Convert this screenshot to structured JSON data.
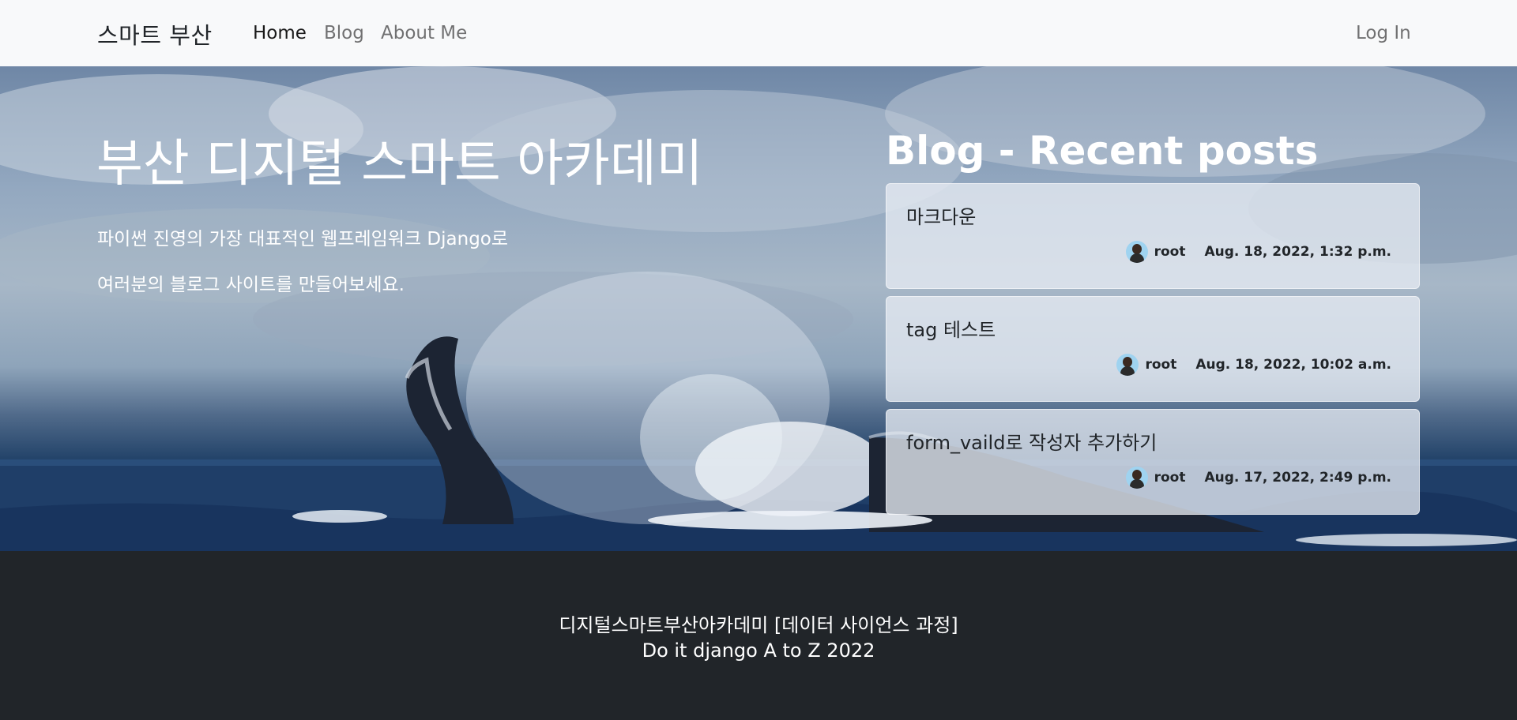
{
  "navbar": {
    "brand": "스마트 부산",
    "links": [
      "Home",
      "Blog",
      "About Me"
    ],
    "login": "Log In"
  },
  "hero": {
    "title": "부산 디지털 스마트 아카데미",
    "description_line1": "파이썬 진영의 가장 대표적인 웹프레임워크 Django로",
    "description_line2": "여러분의 블로그 사이트를 만들어보세요."
  },
  "recent_posts": {
    "heading": "Blog - Recent posts",
    "posts": [
      {
        "title": "마크다운",
        "author": "root",
        "date": "Aug. 18, 2022, 1:32 p.m."
      },
      {
        "title": "tag 테스트",
        "author": "root",
        "date": "Aug. 18, 2022, 10:02 a.m."
      },
      {
        "title": "form_vaild로 작성자 추가하기",
        "author": "root",
        "date": "Aug. 17, 2022, 2:49 p.m."
      }
    ]
  },
  "footer": {
    "line1": "디지털스마트부산아카데미 [데이터 사이언스 과정]",
    "line2": "Do it django A to Z 2022"
  },
  "colors": {
    "navbar_bg": "#f8f9fa",
    "footer_bg": "#212529",
    "card_bg": "#e6ebf2"
  }
}
